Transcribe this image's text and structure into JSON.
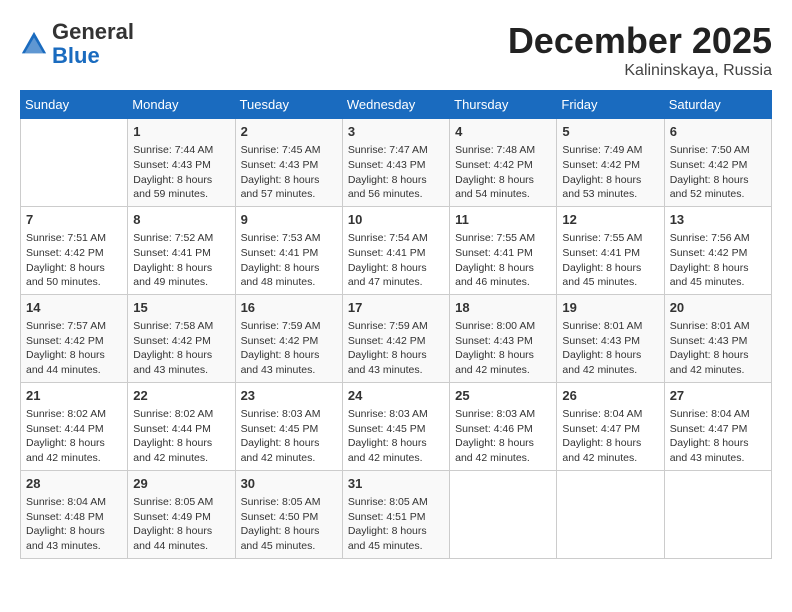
{
  "header": {
    "logo_general": "General",
    "logo_blue": "Blue",
    "month_title": "December 2025",
    "location": "Kalininskaya, Russia"
  },
  "days_of_week": [
    "Sunday",
    "Monday",
    "Tuesday",
    "Wednesday",
    "Thursday",
    "Friday",
    "Saturday"
  ],
  "weeks": [
    [
      {
        "day": "",
        "content": ""
      },
      {
        "day": "1",
        "content": "Sunrise: 7:44 AM\nSunset: 4:43 PM\nDaylight: 8 hours\nand 59 minutes."
      },
      {
        "day": "2",
        "content": "Sunrise: 7:45 AM\nSunset: 4:43 PM\nDaylight: 8 hours\nand 57 minutes."
      },
      {
        "day": "3",
        "content": "Sunrise: 7:47 AM\nSunset: 4:43 PM\nDaylight: 8 hours\nand 56 minutes."
      },
      {
        "day": "4",
        "content": "Sunrise: 7:48 AM\nSunset: 4:42 PM\nDaylight: 8 hours\nand 54 minutes."
      },
      {
        "day": "5",
        "content": "Sunrise: 7:49 AM\nSunset: 4:42 PM\nDaylight: 8 hours\nand 53 minutes."
      },
      {
        "day": "6",
        "content": "Sunrise: 7:50 AM\nSunset: 4:42 PM\nDaylight: 8 hours\nand 52 minutes."
      }
    ],
    [
      {
        "day": "7",
        "content": "Sunrise: 7:51 AM\nSunset: 4:42 PM\nDaylight: 8 hours\nand 50 minutes."
      },
      {
        "day": "8",
        "content": "Sunrise: 7:52 AM\nSunset: 4:41 PM\nDaylight: 8 hours\nand 49 minutes."
      },
      {
        "day": "9",
        "content": "Sunrise: 7:53 AM\nSunset: 4:41 PM\nDaylight: 8 hours\nand 48 minutes."
      },
      {
        "day": "10",
        "content": "Sunrise: 7:54 AM\nSunset: 4:41 PM\nDaylight: 8 hours\nand 47 minutes."
      },
      {
        "day": "11",
        "content": "Sunrise: 7:55 AM\nSunset: 4:41 PM\nDaylight: 8 hours\nand 46 minutes."
      },
      {
        "day": "12",
        "content": "Sunrise: 7:55 AM\nSunset: 4:41 PM\nDaylight: 8 hours\nand 45 minutes."
      },
      {
        "day": "13",
        "content": "Sunrise: 7:56 AM\nSunset: 4:42 PM\nDaylight: 8 hours\nand 45 minutes."
      }
    ],
    [
      {
        "day": "14",
        "content": "Sunrise: 7:57 AM\nSunset: 4:42 PM\nDaylight: 8 hours\nand 44 minutes."
      },
      {
        "day": "15",
        "content": "Sunrise: 7:58 AM\nSunset: 4:42 PM\nDaylight: 8 hours\nand 43 minutes."
      },
      {
        "day": "16",
        "content": "Sunrise: 7:59 AM\nSunset: 4:42 PM\nDaylight: 8 hours\nand 43 minutes."
      },
      {
        "day": "17",
        "content": "Sunrise: 7:59 AM\nSunset: 4:42 PM\nDaylight: 8 hours\nand 43 minutes."
      },
      {
        "day": "18",
        "content": "Sunrise: 8:00 AM\nSunset: 4:43 PM\nDaylight: 8 hours\nand 42 minutes."
      },
      {
        "day": "19",
        "content": "Sunrise: 8:01 AM\nSunset: 4:43 PM\nDaylight: 8 hours\nand 42 minutes."
      },
      {
        "day": "20",
        "content": "Sunrise: 8:01 AM\nSunset: 4:43 PM\nDaylight: 8 hours\nand 42 minutes."
      }
    ],
    [
      {
        "day": "21",
        "content": "Sunrise: 8:02 AM\nSunset: 4:44 PM\nDaylight: 8 hours\nand 42 minutes."
      },
      {
        "day": "22",
        "content": "Sunrise: 8:02 AM\nSunset: 4:44 PM\nDaylight: 8 hours\nand 42 minutes."
      },
      {
        "day": "23",
        "content": "Sunrise: 8:03 AM\nSunset: 4:45 PM\nDaylight: 8 hours\nand 42 minutes."
      },
      {
        "day": "24",
        "content": "Sunrise: 8:03 AM\nSunset: 4:45 PM\nDaylight: 8 hours\nand 42 minutes."
      },
      {
        "day": "25",
        "content": "Sunrise: 8:03 AM\nSunset: 4:46 PM\nDaylight: 8 hours\nand 42 minutes."
      },
      {
        "day": "26",
        "content": "Sunrise: 8:04 AM\nSunset: 4:47 PM\nDaylight: 8 hours\nand 42 minutes."
      },
      {
        "day": "27",
        "content": "Sunrise: 8:04 AM\nSunset: 4:47 PM\nDaylight: 8 hours\nand 43 minutes."
      }
    ],
    [
      {
        "day": "28",
        "content": "Sunrise: 8:04 AM\nSunset: 4:48 PM\nDaylight: 8 hours\nand 43 minutes."
      },
      {
        "day": "29",
        "content": "Sunrise: 8:05 AM\nSunset: 4:49 PM\nDaylight: 8 hours\nand 44 minutes."
      },
      {
        "day": "30",
        "content": "Sunrise: 8:05 AM\nSunset: 4:50 PM\nDaylight: 8 hours\nand 45 minutes."
      },
      {
        "day": "31",
        "content": "Sunrise: 8:05 AM\nSunset: 4:51 PM\nDaylight: 8 hours\nand 45 minutes."
      },
      {
        "day": "",
        "content": ""
      },
      {
        "day": "",
        "content": ""
      },
      {
        "day": "",
        "content": ""
      }
    ]
  ]
}
